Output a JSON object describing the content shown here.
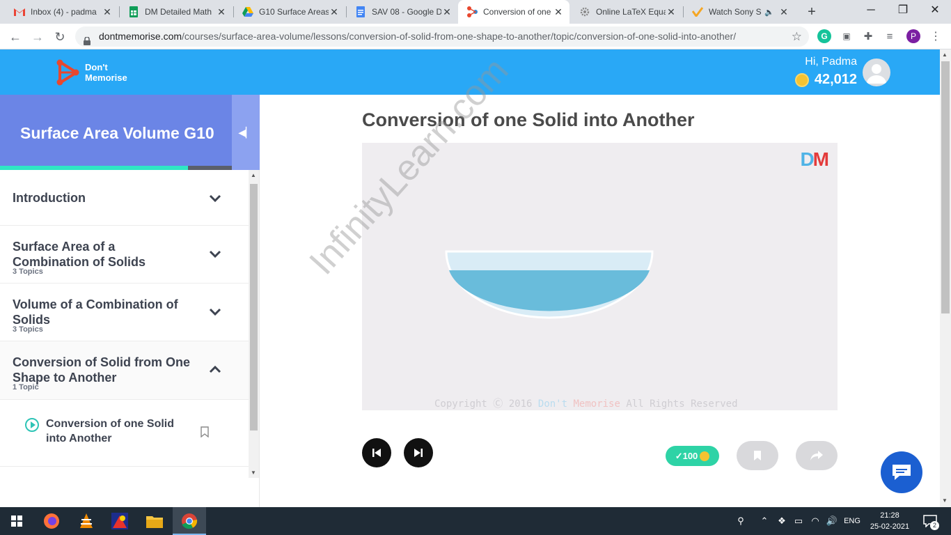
{
  "browser": {
    "tabs": [
      {
        "title": "Inbox (4) - padma",
        "icon": "gmail-icon"
      },
      {
        "title": "DM Detailed Math",
        "icon": "sheets-icon"
      },
      {
        "title": "G10 Surface Areas",
        "icon": "drive-icon"
      },
      {
        "title": "SAV 08 - Google D",
        "icon": "docs-icon"
      },
      {
        "title": "Conversion of one",
        "icon": "dm-icon",
        "active": true
      },
      {
        "title": "Online LaTeX Equa",
        "icon": "gear-icon"
      },
      {
        "title": "Watch Sony S",
        "icon": "sony-icon"
      }
    ],
    "url_host": "dontmemorise.com",
    "url_path": "/courses/surface-area-volume/lessons/conversion-of-solid-from-one-shape-to-another/topic/conversion-of-one-solid-into-another/",
    "profile_initial": "P"
  },
  "header": {
    "logo_line1": "Don't",
    "logo_line2": "Memorise",
    "greeting": "Hi, Padma",
    "coins": "42,012"
  },
  "sidebar": {
    "course_title": "Surface Area Volume G10",
    "progress_percent": 81,
    "sections": [
      {
        "title": "Introduction",
        "topics": "",
        "open": false
      },
      {
        "title": "Surface Area of a Combination of Solids",
        "topics": "3 Topics",
        "open": false
      },
      {
        "title": "Volume of a Combination of Solids",
        "topics": "3 Topics",
        "open": false
      },
      {
        "title": "Conversion of Solid from One Shape to Another",
        "topics": "1 Topic",
        "open": true
      }
    ],
    "lesson": "Conversion of one Solid into Another"
  },
  "main": {
    "title": "Conversion of one Solid into Another",
    "dm_mark": "DM",
    "copyright_prefix": "Copyright",
    "copyright_year": "2016",
    "copyright_dont": "Don't",
    "copyright_memorise": "Memorise",
    "copyright_suffix": "All Rights Reserved",
    "watermark": "InfinityLearn.com",
    "points": "100"
  },
  "taskbar": {
    "language": "ENG",
    "time": "21:28",
    "date": "25-02-2021",
    "notifications": "2"
  },
  "colors": {
    "header_blue": "#29a8f6",
    "sidebar_header": "#6b85e6",
    "progress": "#2ee6c4",
    "teal": "#2ec4b6",
    "water": "#69bcdb"
  }
}
